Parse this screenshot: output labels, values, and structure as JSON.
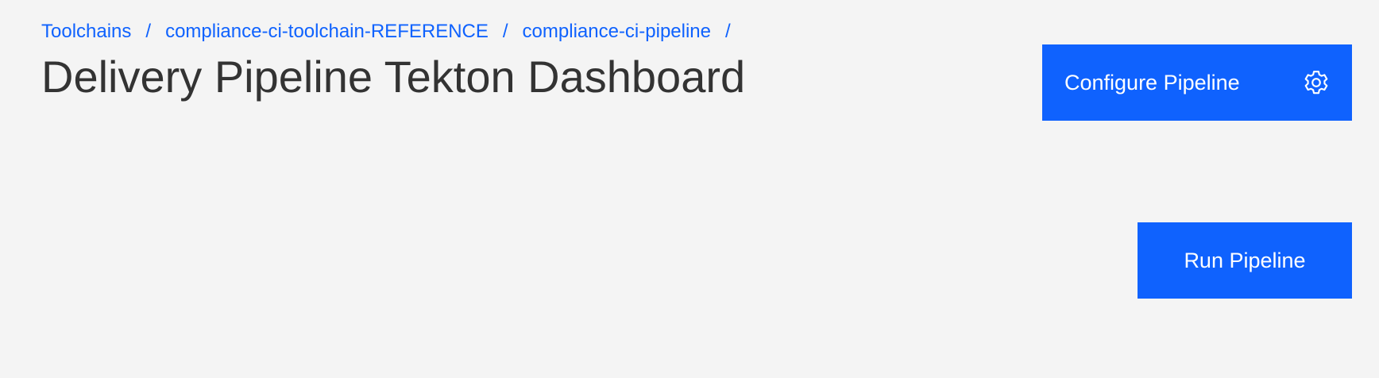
{
  "breadcrumb": {
    "items": [
      {
        "label": "Toolchains"
      },
      {
        "label": "compliance-ci-toolchain-REFERENCE"
      },
      {
        "label": "compliance-ci-pipeline"
      }
    ],
    "separator": "/"
  },
  "header": {
    "title": "Delivery Pipeline Tekton Dashboard"
  },
  "actions": {
    "configure_label": "Configure Pipeline",
    "configure_icon": "gear-icon",
    "run_label": "Run Pipeline"
  },
  "colors": {
    "accent": "#0f62fe",
    "background": "#f4f4f4",
    "title_text": "#333333",
    "button_text": "#ffffff"
  }
}
